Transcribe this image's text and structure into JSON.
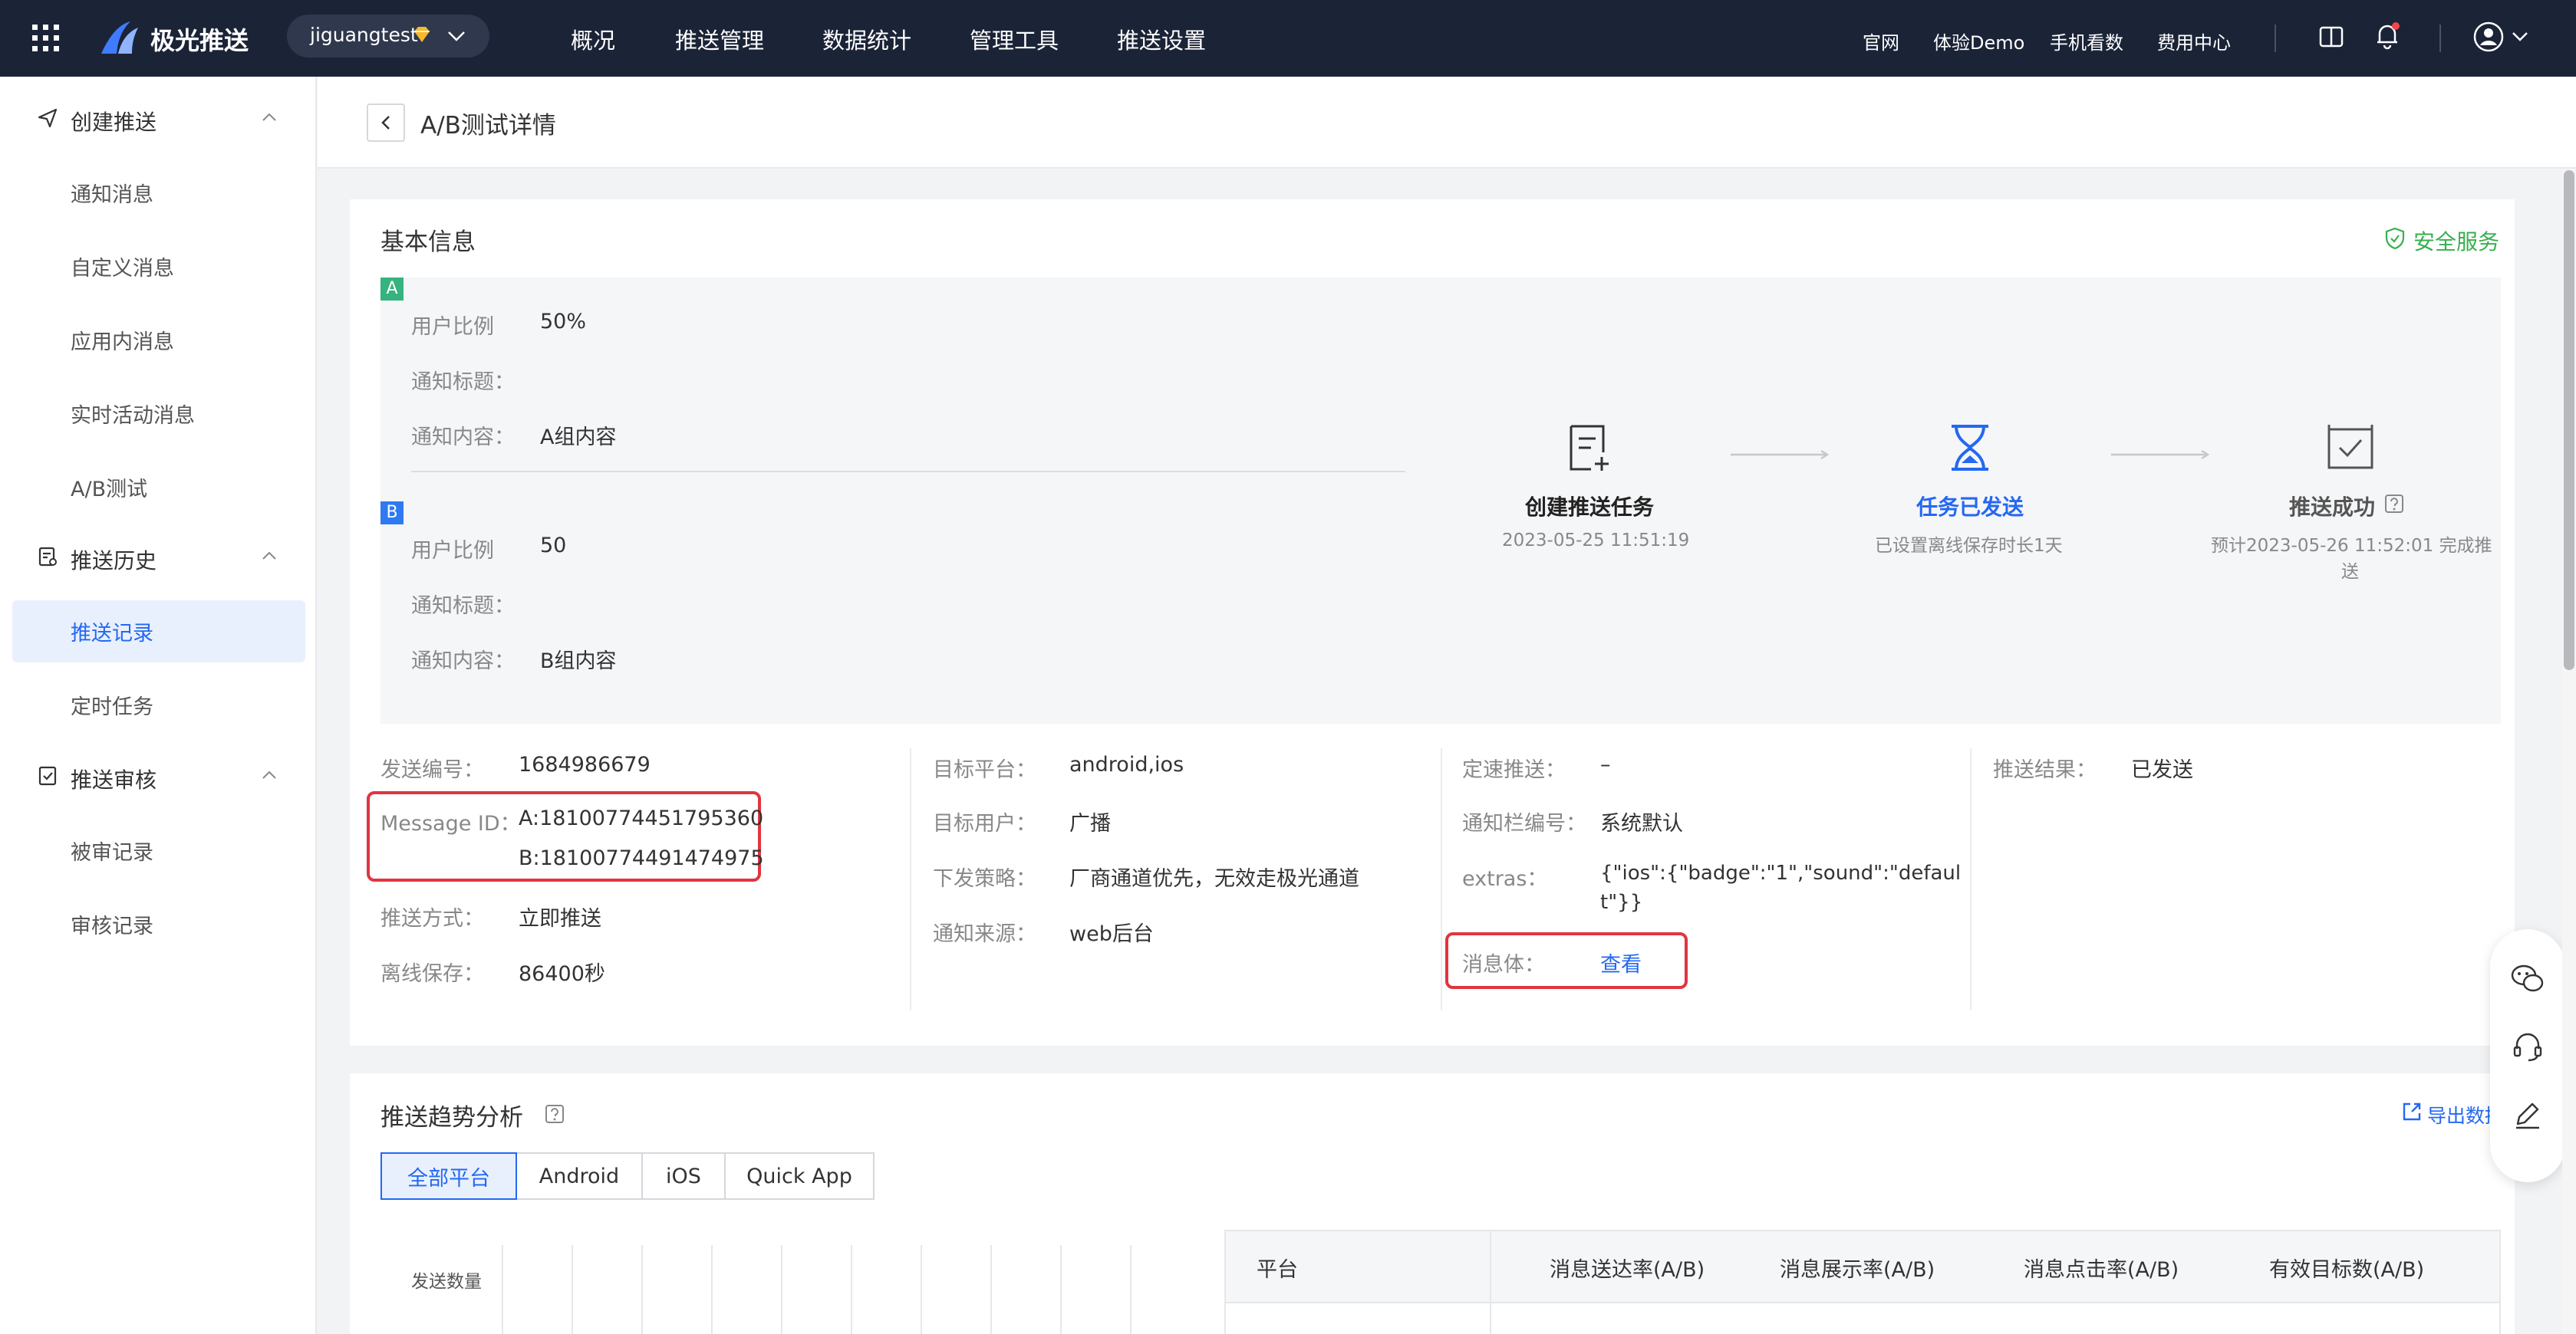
{
  "topbar": {
    "brand": "极光推送",
    "account": "jiguangtest",
    "nav": [
      "概况",
      "推送管理",
      "数据统计",
      "管理工具",
      "推送设置"
    ],
    "active_nav": "推送管理",
    "links": [
      "官网",
      "体验Demo",
      "手机看数",
      "费用中心"
    ]
  },
  "sidebar": {
    "groups": [
      {
        "label": "创建推送",
        "items": [
          "通知消息",
          "自定义消息",
          "应用内消息",
          "实时活动消息",
          "A/B测试"
        ]
      },
      {
        "label": "推送历史",
        "items": [
          "推送记录",
          "定时任务"
        ]
      },
      {
        "label": "推送审核",
        "items": [
          "被审记录",
          "审核记录"
        ]
      }
    ],
    "active_item": "推送记录"
  },
  "page": {
    "title": "A/B测试详情"
  },
  "basic_info": {
    "title": "基本信息",
    "safe_service": "安全服务",
    "group_a": {
      "tag": "A",
      "ratio_label": "用户比例",
      "ratio_value": "50%",
      "title_label": "通知标题：",
      "title_value": "",
      "content_label": "通知内容：",
      "content_value": "A组内容"
    },
    "group_b": {
      "tag": "B",
      "ratio_label": "用户比例",
      "ratio_value": "50",
      "title_label": "通知标题：",
      "title_value": "",
      "content_label": "通知内容：",
      "content_value": "B组内容"
    },
    "steps": [
      {
        "title": "创建推送任务",
        "sub": "2023-05-25 11:51:19"
      },
      {
        "title": "任务已发送",
        "sub": "已设置离线保存时长1天"
      },
      {
        "title": "推送成功",
        "sub": "预计2023-05-26 11:52:01 完成推",
        "sub2": "送"
      }
    ],
    "col1": {
      "send_no_label": "发送编号：",
      "send_no": "1684986679",
      "msgid_label": "Message ID：",
      "msgid_a": "A:18100774451795360",
      "msgid_b": "B:18100774491474975",
      "method_label": "推送方式：",
      "method": "立即推送",
      "offline_label": "离线保存：",
      "offline": "86400秒"
    },
    "col2": {
      "platform_label": "目标平台：",
      "platform": "android,ios",
      "user_label": "目标用户：",
      "user": "广播",
      "strategy_label": "下发策略：",
      "strategy": "厂商通道优先，无效走极光通道",
      "source_label": "通知来源：",
      "source": "web后台"
    },
    "col3": {
      "speed_label": "定速推送：",
      "speed": "–",
      "channel_label": "通知栏编号：",
      "channel": "系统默认",
      "extras_label": "extras：",
      "extras_line1": "{\"ios\":{\"badge\":\"1\",\"sound\":\"defaul",
      "extras_line2": "t\"}}",
      "body_label": "消息体：",
      "body_link": "查看"
    },
    "col4": {
      "result_label": "推送结果：",
      "result": "已发送"
    }
  },
  "trend": {
    "title": "推送趋势分析",
    "export": "导出数据",
    "tabs": [
      "全部平台",
      "Android",
      "iOS",
      "Quick App"
    ],
    "active_tab": "全部平台",
    "chart_ylabel": "发送数量",
    "table_headers": [
      "平台",
      "消息送达率(A/B)",
      "消息展示率(A/B)",
      "消息点击率(A/B)",
      "有效目标数(A/B)"
    ]
  },
  "colors": {
    "accent": "#2468f2",
    "danger": "#e0353f",
    "safe": "#35b04e",
    "topbar": "#1b2337"
  }
}
